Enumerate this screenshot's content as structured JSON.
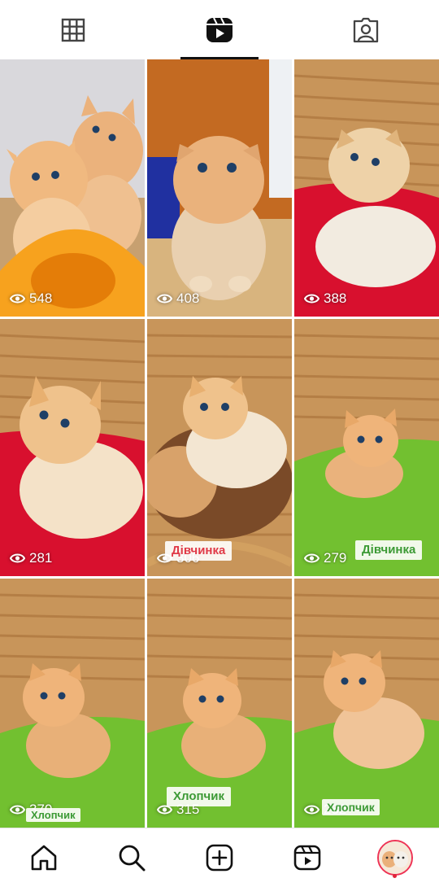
{
  "tabs": [
    {
      "icon": "grid-icon",
      "active": false
    },
    {
      "icon": "reels-icon",
      "active": true
    },
    {
      "icon": "tagged-person-icon",
      "active": false
    }
  ],
  "grid": {
    "tiles": [
      {
        "views": "548",
        "tag": ""
      },
      {
        "views": "408",
        "tag": ""
      },
      {
        "views": "388",
        "tag": ""
      },
      {
        "views": "281",
        "tag": ""
      },
      {
        "views": "306",
        "tag": "Дівчинка",
        "tag_color": "#e03a48"
      },
      {
        "views": "279",
        "tag": "Дівчинка",
        "tag_color": "#3c9a35"
      },
      {
        "views": "370",
        "tag": "Хлопчик",
        "tag_color": "#3c9a35"
      },
      {
        "views": "315",
        "tag": "Хлопчик",
        "tag_color": "#3c9a35"
      },
      {
        "views": "232",
        "tag": "Хлопчик",
        "tag_color": "#3c9a35"
      }
    ]
  },
  "bottom_nav": [
    {
      "icon": "home-icon"
    },
    {
      "icon": "search-icon"
    },
    {
      "icon": "create-icon"
    },
    {
      "icon": "reels-icon"
    },
    {
      "icon": "profile-avatar"
    }
  ],
  "colors": {
    "accent": "#111111",
    "notification_dot": "#e0243a"
  }
}
